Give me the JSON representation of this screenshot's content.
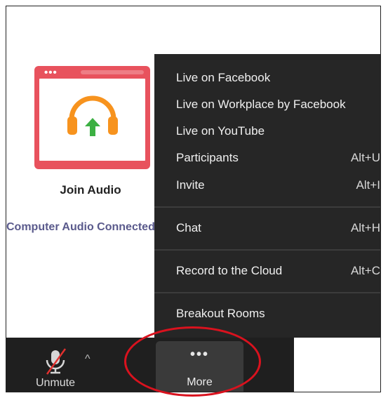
{
  "audio": {
    "title": "Join Audio",
    "subtitle": "Computer Audio Connected",
    "card_icon": "headphones-upload-icon",
    "card_color": "#e8525d"
  },
  "toolbar": {
    "unmute_label": "Unmute",
    "unmute_icon": "mic-muted-icon",
    "caret_icon": "caret-up-icon",
    "more_label": "More",
    "more_icon": "ellipsis-icon"
  },
  "menu": {
    "items": [
      {
        "label": "Live on Facebook",
        "shortcut": ""
      },
      {
        "label": "Live on Workplace by Facebook",
        "shortcut": ""
      },
      {
        "label": "Live on YouTube",
        "shortcut": ""
      },
      {
        "label": "Participants",
        "shortcut": "Alt+U"
      },
      {
        "label": "Invite",
        "shortcut": "Alt+I"
      },
      {
        "label": "Chat",
        "shortcut": "Alt+H"
      },
      {
        "label": "Record to the Cloud",
        "shortcut": "Alt+C"
      },
      {
        "label": "Breakout Rooms",
        "shortcut": ""
      }
    ]
  },
  "colors": {
    "menu_bg": "#262626",
    "toolbar_bg": "#1f1f1f",
    "highlight": "#d9121e",
    "headphone_orange": "#f7931e",
    "arrow_green": "#3cb043"
  }
}
